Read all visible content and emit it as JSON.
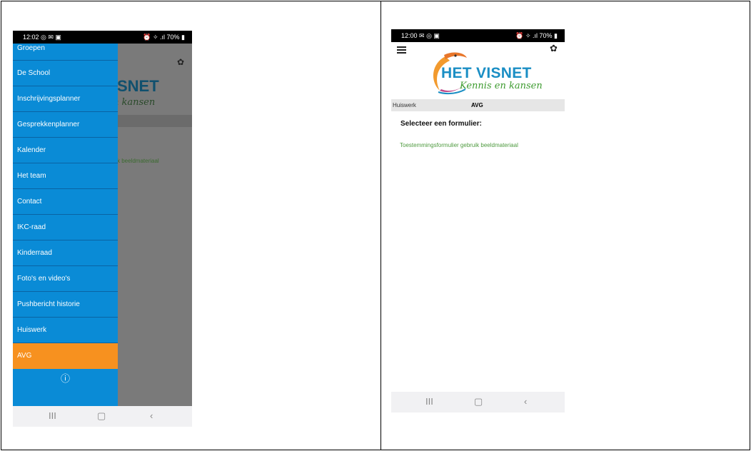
{
  "left_phone": {
    "status": {
      "time": "12:02 ◎ ✉ ▣",
      "right": "⏰ ✧ .ıl 70% ▮"
    },
    "background": {
      "logo_line1": "SNET",
      "logo_line2": "n kansen",
      "link": "k beeldmateriaal"
    },
    "menu": [
      {
        "label": "Groepen"
      },
      {
        "label": "De School"
      },
      {
        "label": "Inschrijvingsplanner"
      },
      {
        "label": "Gesprekkenplanner"
      },
      {
        "label": "Kalender"
      },
      {
        "label": "Het team"
      },
      {
        "label": "Contact"
      },
      {
        "label": "IKC-raad"
      },
      {
        "label": "Kinderraad"
      },
      {
        "label": "Foto's en video's"
      },
      {
        "label": "Pushbericht historie"
      },
      {
        "label": "Huiswerk"
      },
      {
        "label": "AVG",
        "active": true
      }
    ],
    "footer_icon": "ⓘ",
    "navbar": {
      "recents": "III",
      "home": "▢",
      "back": "‹"
    }
  },
  "right_phone": {
    "status": {
      "time": "12:00 ✉ ◎ ▣",
      "right": "⏰ ✧ .ıl 70% ▮"
    },
    "logo": {
      "title": "HET VISNET",
      "subtitle": "Kennis en kansen"
    },
    "tabs": [
      {
        "label": "Huiswerk"
      },
      {
        "label": "AVG",
        "active": true
      }
    ],
    "section_title": "Selecteer een formulier:",
    "form_link": "Toestemmingsformulier gebruik beeldmateriaal",
    "navbar": {
      "recents": "III",
      "home": "▢",
      "back": "‹"
    }
  },
  "colors": {
    "menu_blue": "#0a8bd6",
    "menu_active": "#f7911f",
    "link_green": "#4e9a3f",
    "logo_blue": "#1a8ec4"
  },
  "icons": {
    "gear": "gear-icon",
    "menu": "hamburger-icon",
    "info": "info-icon"
  }
}
